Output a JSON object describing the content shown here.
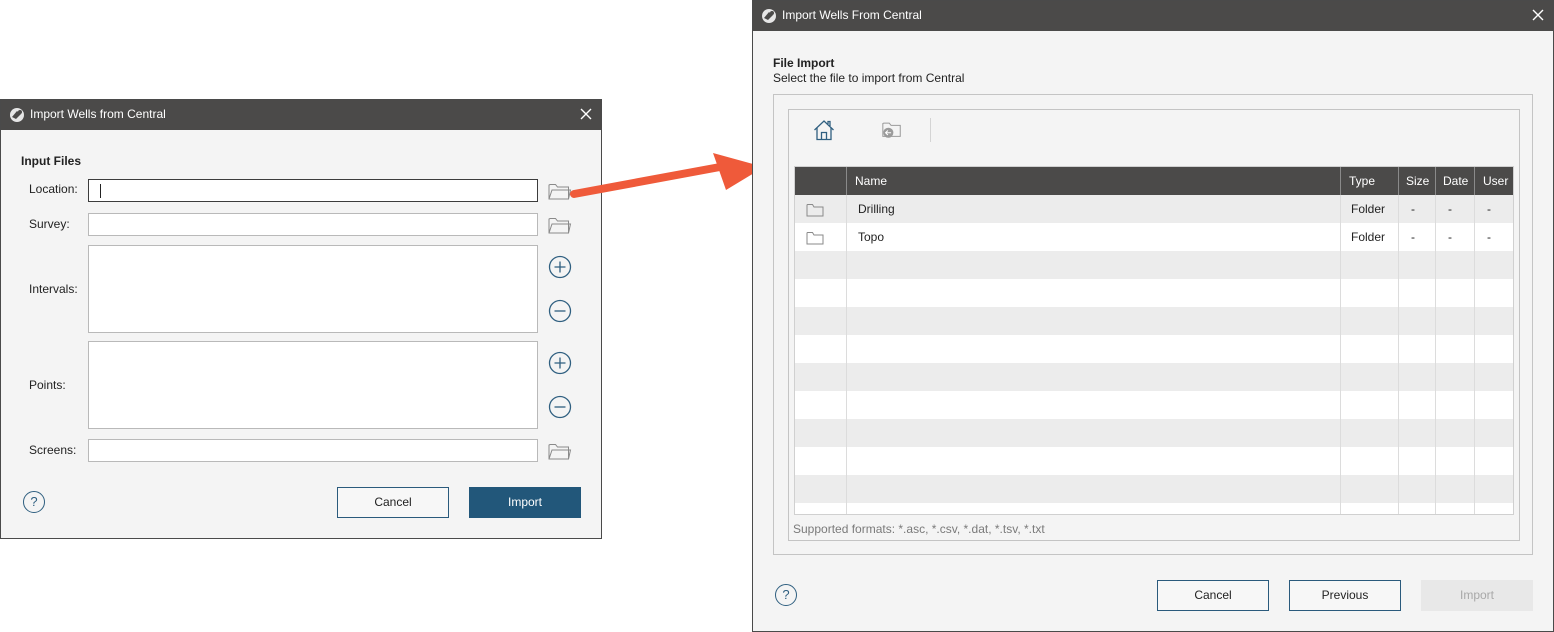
{
  "left_dialog": {
    "title": "Import Wells from Central",
    "section_title": "Input Files",
    "labels": {
      "location": "Location:",
      "survey": "Survey:",
      "intervals": "Intervals:",
      "points": "Points:",
      "screens": "Screens:"
    },
    "values": {
      "location": "",
      "survey": "",
      "screens": ""
    },
    "buttons": {
      "cancel": "Cancel",
      "import": "Import",
      "help": "?"
    }
  },
  "right_dialog": {
    "title": "Import Wells From Central",
    "section_title": "File Import",
    "section_subtitle": "Select the file to import from Central",
    "columns": [
      "Name",
      "Type",
      "Size",
      "Date",
      "User"
    ],
    "rows": [
      {
        "icon": "folder-icon",
        "name": "Drilling",
        "type": "Folder",
        "size": "-",
        "date": "-",
        "user": "-"
      },
      {
        "icon": "folder-icon",
        "name": "Topo",
        "type": "Folder",
        "size": "-",
        "date": "-",
        "user": "-"
      }
    ],
    "supported_formats": "Supported formats: *.asc, *.csv, *.dat, *.tsv, *.txt",
    "buttons": {
      "cancel": "Cancel",
      "previous": "Previous",
      "import": "Import",
      "help": "?"
    }
  },
  "colors": {
    "titlebar": "#4b4a49",
    "primary_button": "#22577a",
    "arrow": "#ef5a3a",
    "grid_header": "#4b4a49"
  }
}
